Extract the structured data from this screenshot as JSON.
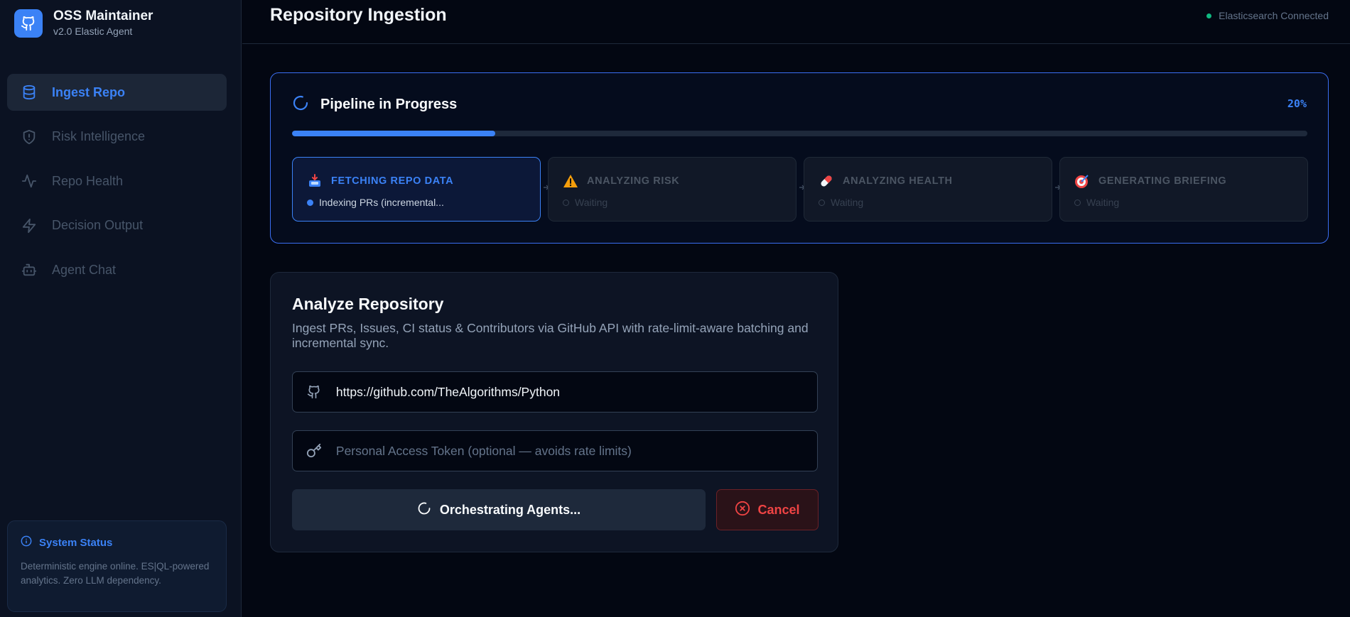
{
  "brand": {
    "title": "OSS Maintainer",
    "subtitle": "v2.0 Elastic Agent",
    "icon": "github-icon"
  },
  "sidebar": {
    "items": [
      {
        "label": "Ingest Repo",
        "icon": "database-icon",
        "active": true
      },
      {
        "label": "Risk Intelligence",
        "icon": "shield-icon",
        "active": false
      },
      {
        "label": "Repo Health",
        "icon": "activity-icon",
        "active": false
      },
      {
        "label": "Decision Output",
        "icon": "zap-icon",
        "active": false
      },
      {
        "label": "Agent Chat",
        "icon": "bot-icon",
        "active": false
      }
    ],
    "status": {
      "title": "System Status",
      "text": "Deterministic engine online. ES|QL-powered analytics. Zero LLM dependency."
    }
  },
  "header": {
    "title": "Repository Ingestion",
    "connection": "Elasticsearch Connected"
  },
  "pipeline": {
    "title": "Pipeline in Progress",
    "percent_label": "20%",
    "progress": 0.2,
    "steps": [
      {
        "title": "FETCHING REPO DATA",
        "icon": "inbox-tray-emoji",
        "status": "Indexing PRs (incremental...",
        "state": "active"
      },
      {
        "title": "ANALYZING RISK",
        "icon": "warning-emoji",
        "status": "Waiting",
        "state": "waiting"
      },
      {
        "title": "ANALYZING HEALTH",
        "icon": "pill-emoji",
        "status": "Waiting",
        "state": "waiting"
      },
      {
        "title": "GENERATING BRIEFING",
        "icon": "target-emoji",
        "status": "Waiting",
        "state": "waiting"
      }
    ]
  },
  "analyze": {
    "title": "Analyze Repository",
    "description": "Ingest PRs, Issues, CI status & Contributors via GitHub API with rate-limit-aware batching and incremental sync.",
    "repo_url": "https://github.com/TheAlgorithms/Python",
    "token_placeholder": "Personal Access Token (optional — avoids rate limits)",
    "run_label": "Orchestrating Agents...",
    "cancel_label": "Cancel"
  },
  "colors": {
    "accent": "#3b82f6",
    "success": "#10b981",
    "danger": "#ef4444",
    "background": "#030712"
  }
}
